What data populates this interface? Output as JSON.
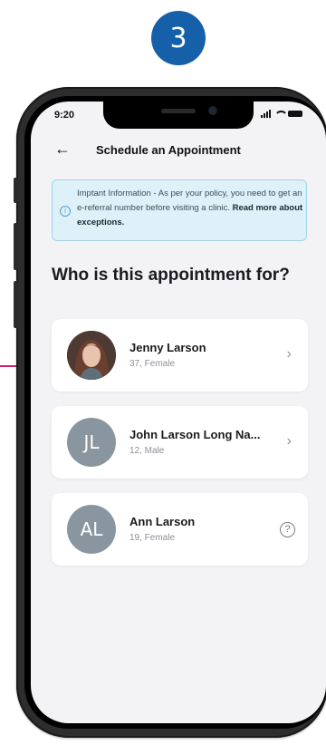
{
  "step": "3",
  "status_bar": {
    "time": "9:20"
  },
  "header": {
    "title": "Schedule an Appointment"
  },
  "info": {
    "text": "Imptant Information - As per your policy, you need to get an e-referral number before visiting a clinic.",
    "link": "Read more about exceptions."
  },
  "question": "Who is this appointment for?",
  "people": [
    {
      "name": "Jenny Larson",
      "meta": "37, Female",
      "initials": "",
      "action": "chevron"
    },
    {
      "name": "John Larson Long Na...",
      "meta": "12, Male",
      "initials": "JL",
      "action": "chevron"
    },
    {
      "name": "Ann Larson",
      "meta": "19, Female",
      "initials": "AL",
      "action": "help"
    }
  ],
  "colors": {
    "accent": "#1560a8",
    "pointer": "#c2226b",
    "info_bg": "#dff1f8"
  }
}
